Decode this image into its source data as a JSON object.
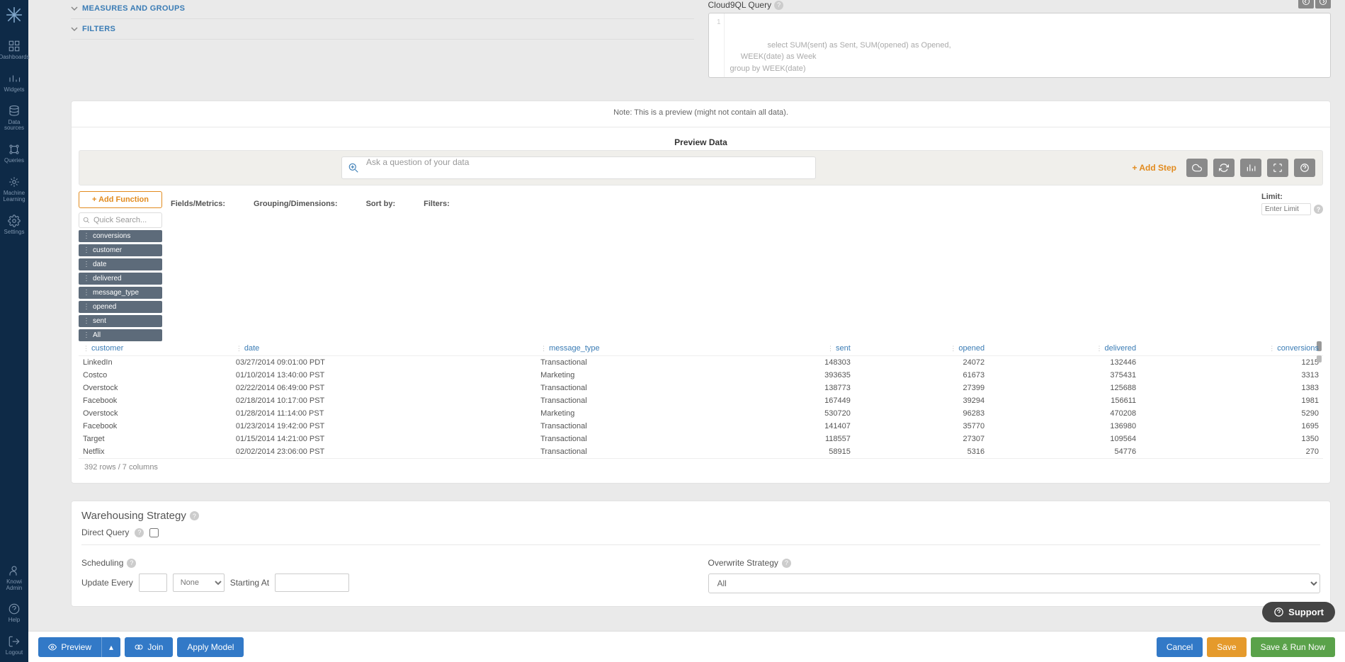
{
  "sidebar": {
    "items": [
      {
        "label": "Dashboards"
      },
      {
        "label": "Widgets"
      },
      {
        "label": "Data\nsources"
      },
      {
        "label": "Queries"
      },
      {
        "label": "Machine\nLearning"
      },
      {
        "label": "Settings"
      }
    ],
    "bottom": [
      {
        "label": "Knowi\nAdmin"
      },
      {
        "label": "Help"
      },
      {
        "label": "Logout"
      }
    ]
  },
  "collapse": {
    "measures": "MEASURES AND GROUPS",
    "filters": "FILTERS"
  },
  "cloud9": {
    "label": "Cloud9QL Query",
    "code": "select SUM(sent) as Sent, SUM(opened) as Opened,\n     WEEK(date) as Week\ngroup by WEEK(date)"
  },
  "preview": {
    "note": "Note: This is a preview (might not contain all data).",
    "title": "Preview Data",
    "ask_placeholder": "Ask a question of your data",
    "add_step": "+ Add Step",
    "add_function": "+ Add Function",
    "quick_search": "Quick Search...",
    "pills": [
      "conversions",
      "customer",
      "date",
      "delivered",
      "message_type",
      "opened",
      "sent",
      "All"
    ],
    "builder_cols": {
      "fields": "Fields/Metrics:",
      "grouping": "Grouping/Dimensions:",
      "sort": "Sort by:",
      "filters": "Filters:",
      "limit": "Limit:",
      "limit_ph": "Enter Limit"
    },
    "columns": [
      "customer",
      "date",
      "message_type",
      "sent",
      "opened",
      "delivered",
      "conversions"
    ],
    "rows": [
      {
        "customer": "LinkedIn",
        "date": "03/27/2014 09:01:00 PDT",
        "message_type": "Transactional",
        "sent": 148303,
        "opened": 24072,
        "delivered": 132446,
        "conversions": 1215
      },
      {
        "customer": "Costco",
        "date": "01/10/2014 13:40:00 PST",
        "message_type": "Marketing",
        "sent": 393635,
        "opened": 61673,
        "delivered": 375431,
        "conversions": 3313
      },
      {
        "customer": "Overstock",
        "date": "02/22/2014 06:49:00 PST",
        "message_type": "Transactional",
        "sent": 138773,
        "opened": 27399,
        "delivered": 125688,
        "conversions": 1383
      },
      {
        "customer": "Facebook",
        "date": "02/18/2014 10:17:00 PST",
        "message_type": "Transactional",
        "sent": 167449,
        "opened": 39294,
        "delivered": 156611,
        "conversions": 1981
      },
      {
        "customer": "Overstock",
        "date": "01/28/2014 11:14:00 PST",
        "message_type": "Marketing",
        "sent": 530720,
        "opened": 96283,
        "delivered": 470208,
        "conversions": 5290
      },
      {
        "customer": "Facebook",
        "date": "01/23/2014 19:42:00 PST",
        "message_type": "Transactional",
        "sent": 141407,
        "opened": 35770,
        "delivered": 136980,
        "conversions": 1695
      },
      {
        "customer": "Target",
        "date": "01/15/2014 14:21:00 PST",
        "message_type": "Transactional",
        "sent": 118557,
        "opened": 27307,
        "delivered": 109564,
        "conversions": 1350
      },
      {
        "customer": "Netflix",
        "date": "02/02/2014 23:06:00 PST",
        "message_type": "Transactional",
        "sent": 58915,
        "opened": 5316,
        "delivered": 54776,
        "conversions": 270
      }
    ],
    "footer": "392 rows / 7 columns"
  },
  "warehousing": {
    "title": "Warehousing Strategy",
    "direct": "Direct Query"
  },
  "scheduling": {
    "title": "Scheduling",
    "update_every": "Update Every",
    "none": "None",
    "starting_at": "Starting At"
  },
  "overwrite": {
    "title": "Overwrite Strategy",
    "value": "All"
  },
  "footer": {
    "preview": "Preview",
    "join": "Join",
    "apply_model": "Apply Model",
    "cancel": "Cancel",
    "save": "Save",
    "save_run": "Save & Run Now"
  },
  "support": "Support"
}
